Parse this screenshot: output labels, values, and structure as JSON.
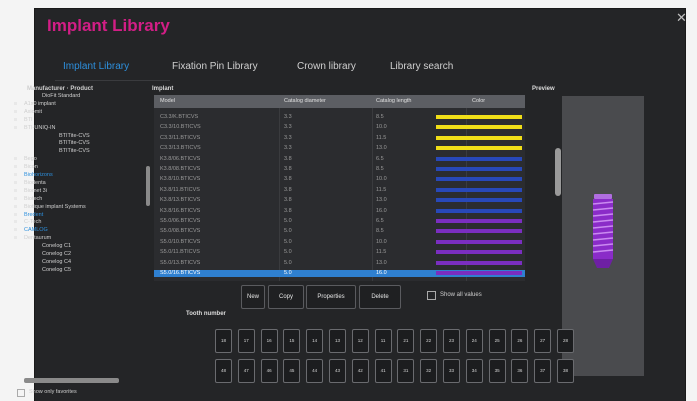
{
  "window": {
    "title": "Implant Library",
    "close_icon": "close-icon"
  },
  "tabs": [
    {
      "label": "Implant Library",
      "active": true
    },
    {
      "label": "Fixation Pin Library",
      "active": false
    },
    {
      "label": "Crown library",
      "active": false
    },
    {
      "label": "Library search",
      "active": false
    }
  ],
  "tree": {
    "header": "Manufacturer · Product",
    "items": [
      {
        "label": "DioFit Standard",
        "level": 1,
        "hl": false
      },
      {
        "label": "A1x0 implant",
        "level": 0,
        "hl": false
      },
      {
        "label": "Axiomit",
        "level": 0,
        "hl": false
      },
      {
        "label": "BTI",
        "level": 0,
        "hl": false
      },
      {
        "label": "BTI-UNIQ-IN",
        "level": 0,
        "hl": false
      },
      {
        "label": "BTITite-CVS",
        "level": 2,
        "hl": false
      },
      {
        "label": "BTITite-CVS",
        "level": 2,
        "hl": false
      },
      {
        "label": "BTITite-CVS",
        "level": 2,
        "hl": false
      },
      {
        "label": "Bego",
        "level": 0,
        "hl": false
      },
      {
        "label": "Bicon",
        "level": 0,
        "hl": false
      },
      {
        "label": "Biohorizons",
        "level": 0,
        "hl": true
      },
      {
        "label": "Biodenta",
        "level": 0,
        "hl": false
      },
      {
        "label": "Biomet 3i",
        "level": 0,
        "hl": false
      },
      {
        "label": "Biotech",
        "level": 0,
        "hl": false
      },
      {
        "label": "Biotique implant Systems",
        "level": 0,
        "hl": false
      },
      {
        "label": "Bredent",
        "level": 0,
        "hl": true
      },
      {
        "label": "C-Tech",
        "level": 0,
        "hl": false
      },
      {
        "label": "CAMLOG",
        "level": 0,
        "hl": true
      },
      {
        "label": "Dentaurum",
        "level": 0,
        "hl": false
      },
      {
        "label": "Conelog C1",
        "level": 1,
        "hl": false
      },
      {
        "label": "Conelog C2",
        "level": 1,
        "hl": false
      },
      {
        "label": "Conelog C4",
        "level": 1,
        "hl": false
      },
      {
        "label": "Conelog C5",
        "level": 1,
        "hl": false
      }
    ],
    "show_only_favorites": "Show only favorites"
  },
  "implant_table": {
    "label": "Implant",
    "columns": [
      "Model",
      "Catalog diameter",
      "Catalog length",
      "Color"
    ],
    "rows": [
      {
        "model": "C3.3/K.BTICVS",
        "diameter": "3.3",
        "length": "8.5",
        "color": "#f0de18"
      },
      {
        "model": "C3.3/10.BTICVS",
        "diameter": "3.3",
        "length": "10.0",
        "color": "#f0de18"
      },
      {
        "model": "C3.3/11.BTICVS",
        "diameter": "3.3",
        "length": "11.5",
        "color": "#f0de18"
      },
      {
        "model": "C3.3/13.BTICVS",
        "diameter": "3.3",
        "length": "13.0",
        "color": "#f0de18"
      },
      {
        "model": "K3.8/06.BTICVS",
        "diameter": "3.8",
        "length": "6.5",
        "color": "#2848b8"
      },
      {
        "model": "K3.8/08.BTICVS",
        "diameter": "3.8",
        "length": "8.5",
        "color": "#2848b8"
      },
      {
        "model": "K3.8/10.BTICVS",
        "diameter": "3.8",
        "length": "10.0",
        "color": "#2848b8"
      },
      {
        "model": "K3.8/11.BTICVS",
        "diameter": "3.8",
        "length": "11.5",
        "color": "#2848b8"
      },
      {
        "model": "K3.8/13.BTICVS",
        "diameter": "3.8",
        "length": "13.0",
        "color": "#2848b8"
      },
      {
        "model": "K3.8/16.BTICVS",
        "diameter": "3.8",
        "length": "16.0",
        "color": "#2848b8"
      },
      {
        "model": "S5.0/06.BTICVS",
        "diameter": "5.0",
        "length": "6.5",
        "color": "#7a2ec0"
      },
      {
        "model": "S5.0/08.BTICVS",
        "diameter": "5.0",
        "length": "8.5",
        "color": "#7a2ec0"
      },
      {
        "model": "S5.0/10.BTICVS",
        "diameter": "5.0",
        "length": "10.0",
        "color": "#7a2ec0"
      },
      {
        "model": "S5.0/11.BTICVS",
        "diameter": "5.0",
        "length": "11.5",
        "color": "#7a2ec0"
      },
      {
        "model": "S5.0/13.BTICVS",
        "diameter": "5.0",
        "length": "13.0",
        "color": "#7a2ec0"
      },
      {
        "model": "S5.0/16.BTICVS",
        "diameter": "5.0",
        "length": "16.0",
        "color": "#7a2ec0",
        "selected": true
      }
    ]
  },
  "preview": {
    "label": "Preview",
    "implant_color": "#8a2cc8"
  },
  "buttons": {
    "new": "New",
    "copy": "Copy",
    "properties": "Properties",
    "delete": "Delete",
    "show_all_values": "Show all values"
  },
  "tooth_numbers": {
    "label": "Tooth number",
    "upper": [
      "18",
      "17",
      "16",
      "15",
      "14",
      "13",
      "12",
      "11",
      "21",
      "22",
      "23",
      "24",
      "25",
      "26",
      "27",
      "28"
    ],
    "lower": [
      "48",
      "47",
      "46",
      "45",
      "44",
      "43",
      "42",
      "41",
      "31",
      "32",
      "33",
      "34",
      "35",
      "36",
      "37",
      "38"
    ]
  },
  "colors": {
    "accent_title": "#d21e86",
    "accent_tab": "#2d8fdc",
    "selection": "#2f80d0"
  }
}
